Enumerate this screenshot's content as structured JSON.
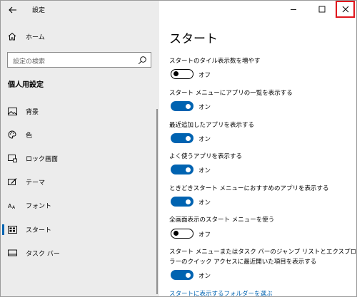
{
  "app": {
    "title": "設定"
  },
  "sidebar": {
    "home_label": "ホーム",
    "search_placeholder": "設定の検索",
    "section_title": "個人用設定",
    "items": [
      {
        "label": "背景",
        "icon": "picture-icon"
      },
      {
        "label": "色",
        "icon": "palette-icon"
      },
      {
        "label": "ロック画面",
        "icon": "lock-screen-icon"
      },
      {
        "label": "テーマ",
        "icon": "theme-icon"
      },
      {
        "label": "フォント",
        "icon": "font-icon"
      },
      {
        "label": "スタート",
        "icon": "start-icon",
        "active": true
      },
      {
        "label": "タスク バー",
        "icon": "taskbar-icon"
      }
    ]
  },
  "main": {
    "title": "スタート",
    "settings": [
      {
        "label": "スタートのタイル表示数を増やす",
        "state": "オフ",
        "on": false
      },
      {
        "label": "スタート メニューにアプリの一覧を表示する",
        "state": "オン",
        "on": true
      },
      {
        "label": "最近追加したアプリを表示する",
        "state": "オン",
        "on": true
      },
      {
        "label": "よく使うアプリを表示する",
        "state": "オン",
        "on": true
      },
      {
        "label": "ときどきスタート メニューにおすすめのアプリを表示する",
        "state": "オン",
        "on": true
      },
      {
        "label": "全画面表示のスタート メニューを使う",
        "state": "オフ",
        "on": false
      },
      {
        "label_line1": "スタート メニューまたはタスク バーのジャンプ リストとエクスプロー",
        "label_line2": "ラーのクイック アクセスに最近開いた項目を表示する",
        "state": "オン",
        "on": true
      }
    ],
    "folder_link": "スタートに表示するフォルダーを選ぶ"
  },
  "colors": {
    "accent": "#0063b1",
    "close_highlight": "#e0161c",
    "sidebar_bg": "#ececec"
  }
}
